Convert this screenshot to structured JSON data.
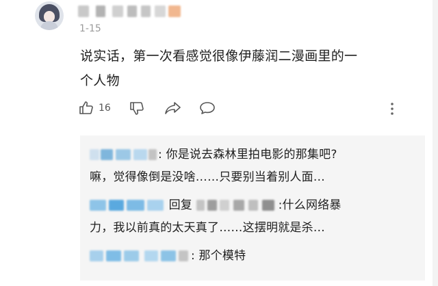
{
  "comment": {
    "date": "1-15",
    "text_line1": "说实话，第一次看感觉很像伊藤润二漫画里的一",
    "text_line2": "个人物",
    "like_count": "16"
  },
  "icons": {
    "like": "thumbs-up-icon",
    "dislike": "thumbs-down-icon",
    "share": "share-icon",
    "reply": "comment-bubble-icon",
    "more": "more-vertical-icon"
  },
  "replies": [
    {
      "suffix": ": 你是说去森林里拍电影的那集吧?",
      "line2": "嘛，觉得像倒是没啥……只要别当着别人面…"
    },
    {
      "reply_word": "回复",
      "suffix": ":什么网络暴",
      "line2": "力，我以前真的太天真了……这摆明就是杀…"
    },
    {
      "suffix": ": 那个模特"
    }
  ],
  "colors": {
    "background": "#ffffff",
    "reply_background": "#f5f5f5",
    "date": "#9a9a9a",
    "text": "#1f1f1f"
  }
}
